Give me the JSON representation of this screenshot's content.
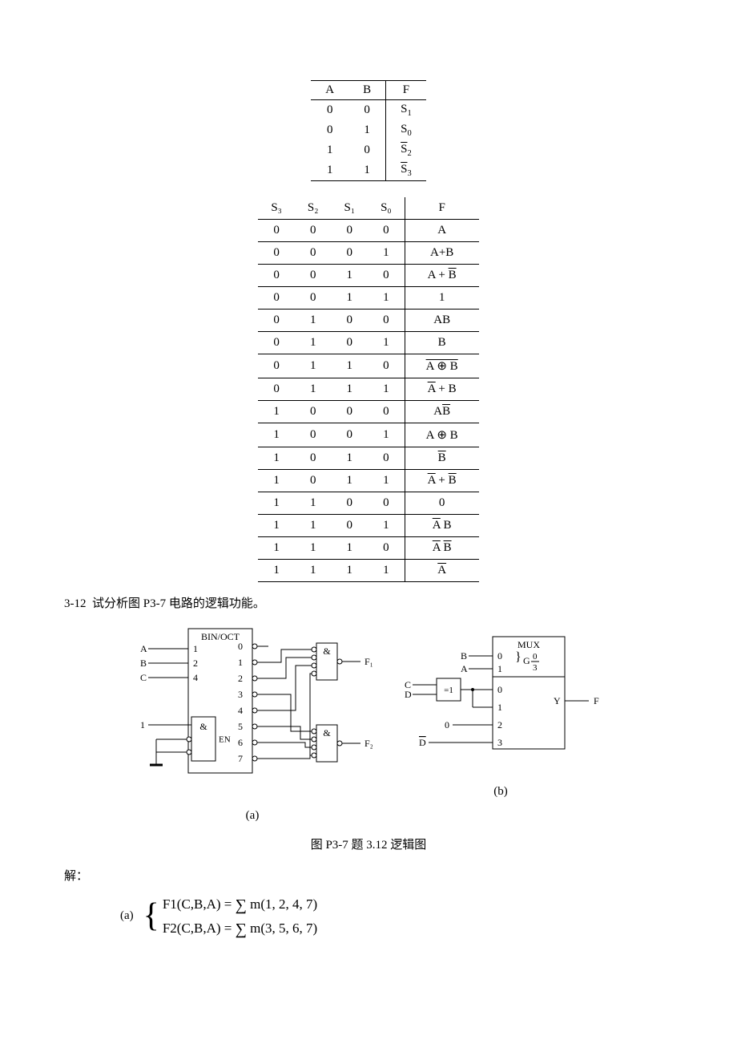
{
  "table1": {
    "headers": [
      "A",
      "B",
      "F"
    ],
    "rows": [
      [
        "0",
        "0",
        {
          "t": "S",
          "sub": "1"
        }
      ],
      [
        "0",
        "1",
        {
          "t": "S",
          "sub": "0"
        }
      ],
      [
        "1",
        "0",
        {
          "t": "S",
          "sub": "2",
          "bar": true
        }
      ],
      [
        "1",
        "1",
        {
          "t": "S",
          "sub": "3",
          "bar": true
        }
      ]
    ]
  },
  "table2": {
    "headers": [
      "S₃",
      "S₂",
      "S₁",
      "S₀",
      "F"
    ],
    "rows": [
      [
        "0",
        "0",
        "0",
        "0",
        [
          {
            "t": "A"
          }
        ]
      ],
      [
        "0",
        "0",
        "0",
        "1",
        [
          {
            "t": "A+B"
          }
        ]
      ],
      [
        "0",
        "0",
        "1",
        "0",
        [
          {
            "t": "A + "
          },
          {
            "t": "B",
            "bar": true
          }
        ]
      ],
      [
        "0",
        "0",
        "1",
        "1",
        [
          {
            "t": "1"
          }
        ]
      ],
      [
        "0",
        "1",
        "0",
        "0",
        [
          {
            "t": "AB"
          }
        ]
      ],
      [
        "0",
        "1",
        "0",
        "1",
        [
          {
            "t": "B"
          }
        ]
      ],
      [
        "0",
        "1",
        "1",
        "0",
        [
          {
            "t": "A ⊕ B",
            "bar": true
          }
        ]
      ],
      [
        "0",
        "1",
        "1",
        "1",
        [
          {
            "t": "A",
            "bar": true
          },
          {
            "t": " + B"
          }
        ]
      ],
      [
        "1",
        "0",
        "0",
        "0",
        [
          {
            "t": "A"
          },
          {
            "t": "B",
            "bar": true
          }
        ]
      ],
      [
        "1",
        "0",
        "0",
        "1",
        [
          {
            "t": "A ⊕ B"
          }
        ]
      ],
      [
        "1",
        "0",
        "1",
        "0",
        [
          {
            "t": "B",
            "bar": true
          }
        ]
      ],
      [
        "1",
        "0",
        "1",
        "1",
        [
          {
            "t": "A",
            "bar": true
          },
          {
            "t": " + "
          },
          {
            "t": "B",
            "bar": true
          }
        ]
      ],
      [
        "1",
        "1",
        "0",
        "0",
        [
          {
            "t": "0"
          }
        ]
      ],
      [
        "1",
        "1",
        "0",
        "1",
        [
          {
            "t": "A",
            "bar": true
          },
          {
            "t": " B"
          }
        ]
      ],
      [
        "1",
        "1",
        "1",
        "0",
        [
          {
            "t": "A",
            "bar": true
          },
          {
            "t": " "
          },
          {
            "t": "B",
            "bar": true
          }
        ]
      ],
      [
        "1",
        "1",
        "1",
        "1",
        [
          {
            "t": "A",
            "bar": true
          }
        ]
      ]
    ]
  },
  "problem": {
    "num": "3-12",
    "text": "试分析图 P3-7 电路的逻辑功能。"
  },
  "circuit_a": {
    "block_label": "BIN/OCT",
    "inputs": [
      {
        "n": "A",
        "p": "1"
      },
      {
        "n": "B",
        "p": "2"
      },
      {
        "n": "C",
        "p": "4"
      }
    ],
    "en_input": "1",
    "and_label": "&",
    "en_label": "EN",
    "outs": [
      "0",
      "1",
      "2",
      "3",
      "4",
      "5",
      "6",
      "7"
    ],
    "nand_label": "&",
    "f1": "F₁",
    "f2": "F₂",
    "cap": "(a)"
  },
  "circuit_b": {
    "block_label": "MUX",
    "sel": [
      {
        "n": "B",
        "p": "0"
      },
      {
        "n": "A",
        "p": "1"
      }
    ],
    "g_label": "G",
    "g_frac_top": "0",
    "g_frac_bot": "3",
    "d_inputs": [
      "0",
      "1",
      "2",
      "3"
    ],
    "xor_in1": "C",
    "xor_in2": "D",
    "xor_label": "=1",
    "const0": "0",
    "d_bar": "D",
    "y_label": "Y",
    "f_label": "F",
    "cap": "(b)"
  },
  "figcap": "图 P3-7  题 3.12 逻辑图",
  "solution_label": "解：",
  "equations": {
    "label": "(a)",
    "lines": [
      "F1(C,B,A) = ∑ m(1, 2, 4, 7)",
      "F2(C,B,A) = ∑ m(3, 5, 6, 7)"
    ]
  }
}
